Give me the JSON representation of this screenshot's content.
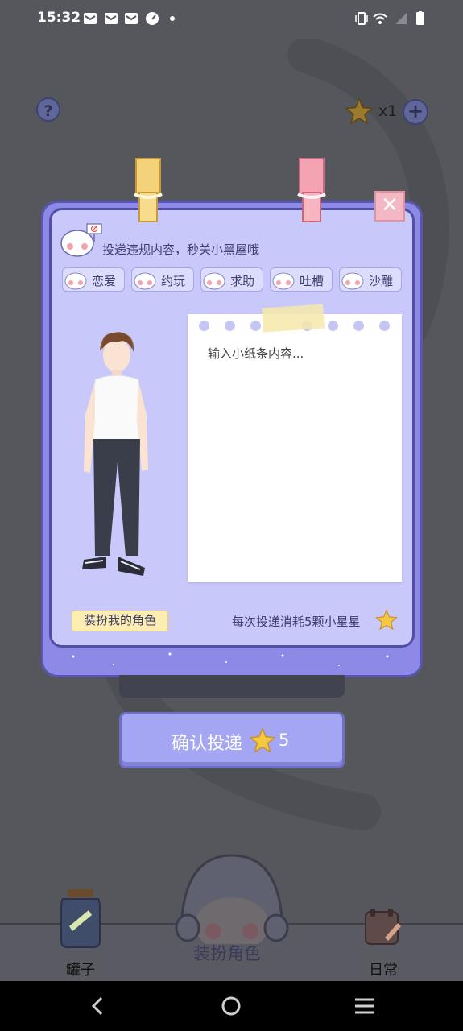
{
  "status_bar": {
    "time": "15:32"
  },
  "top": {
    "help_label": "?",
    "star_count": "x1",
    "add_label": "+"
  },
  "dialog": {
    "close_label": "✕",
    "warning": "投递违规内容，秒关小黑屋哦",
    "tags": [
      "恋爱",
      "约玩",
      "求助",
      "吐槽",
      "沙雕"
    ],
    "note_placeholder": "输入小纸条内容...",
    "dress_button": "装扮我的角色",
    "cost_text": "每次投递消耗5颗小星星"
  },
  "confirm": {
    "label": "确认投递",
    "cost": "5"
  },
  "bottom_nav": {
    "jar": "罐子",
    "dress": "装扮角色",
    "daily": "日常"
  },
  "colors": {
    "accent": "#8c8ae6",
    "panel": "#c8c8fb",
    "star": "#f5c842",
    "close": "#f4b8c4"
  }
}
